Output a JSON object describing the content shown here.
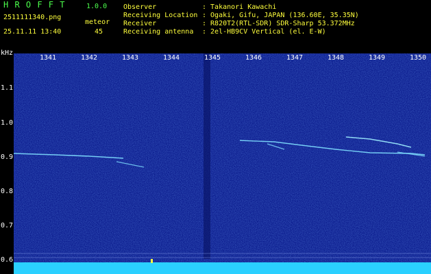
{
  "header": {
    "app_name": "H R O F F T",
    "version": "1.0.0",
    "filename": "2511111340.png",
    "meteor_label": "meteor",
    "datetime": "25.11.11 13:40",
    "meteor_count": "45",
    "observer_label": "Observer",
    "observer_value": ": Takanori Kawachi",
    "location_label": "Receiving Location",
    "location_value": ": Ogaki, Gifu, JAPAN (136.60E, 35.35N)",
    "receiver_label": "Receiver",
    "receiver_value": ": R820T2(RTL-SDR) SDR-Sharp 53.372MHz",
    "antenna_label": "Receiving antenna",
    "antenna_value": ": 2el-HB9CV Vertical (el. E-W)"
  },
  "axis": {
    "unit": "kHz",
    "y_ticks": [
      "1.1",
      "1.0",
      "0.9",
      "0.8",
      "0.7",
      "0.6"
    ],
    "x_ticks": [
      "1341",
      "1342",
      "1343",
      "1344",
      "1345",
      "1346",
      "1347",
      "1348",
      "1349",
      "1350"
    ]
  },
  "colors": {
    "background": "#000000",
    "spectrogram": "#0a1a8c",
    "signal": "#7fe0ff",
    "header_yellow": "#ffff3c",
    "header_green": "#4cff4c"
  }
}
